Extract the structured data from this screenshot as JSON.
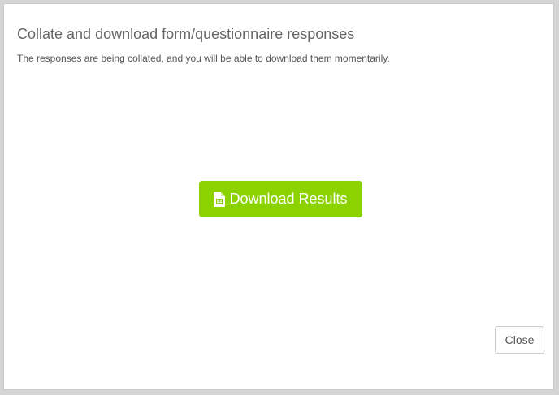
{
  "dialog": {
    "title": "Collate and download form/questionnaire responses",
    "description": "The responses are being collated, and you will be able to download them momentarily.",
    "download_button": {
      "label": "Download Results",
      "icon": "spreadsheet-file-icon",
      "color": "#8cd100"
    },
    "close_button": {
      "label": "Close"
    }
  }
}
